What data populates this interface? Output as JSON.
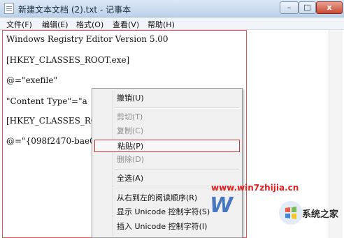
{
  "window": {
    "title": "新建文本文档 (2).txt - 记事本",
    "minimize": "–",
    "maximize": "□",
    "close": "x"
  },
  "menubar": [
    "文件(F)",
    "编辑(E)",
    "格式(O)",
    "查看(V)",
    "帮助(H)"
  ],
  "editor": {
    "lines": [
      "Windows Registry Editor Version 5.00",
      "[HKEY_CLASSES_ROOT.exe]",
      "@=\"exefile\"",
      "\"Content Type\"=\"a",
      "[HKEY_CLASSES_ROOT",
      "@=\"{098f2470-bae0"
    ]
  },
  "context_menu": {
    "items": [
      {
        "label": "撤销(U)",
        "enabled": true
      },
      {
        "label": "剪切(T)",
        "enabled": false
      },
      {
        "label": "复制(C)",
        "enabled": false
      },
      {
        "label": "粘贴(P)",
        "enabled": true,
        "highlighted": true
      },
      {
        "label": "删除(D)",
        "enabled": false
      },
      {
        "label": "全选(A)",
        "enabled": true
      },
      {
        "label": "从右到左的阅读顺序(R)",
        "enabled": true
      },
      {
        "label": "显示 Unicode 控制字符(S)",
        "enabled": true
      },
      {
        "label": "插入 Unicode 控制字符(I)",
        "enabled": true
      }
    ]
  },
  "watermark": {
    "url": "www.win7zhijia.cn",
    "logo_letter": "W",
    "site_name": "系统之家"
  }
}
